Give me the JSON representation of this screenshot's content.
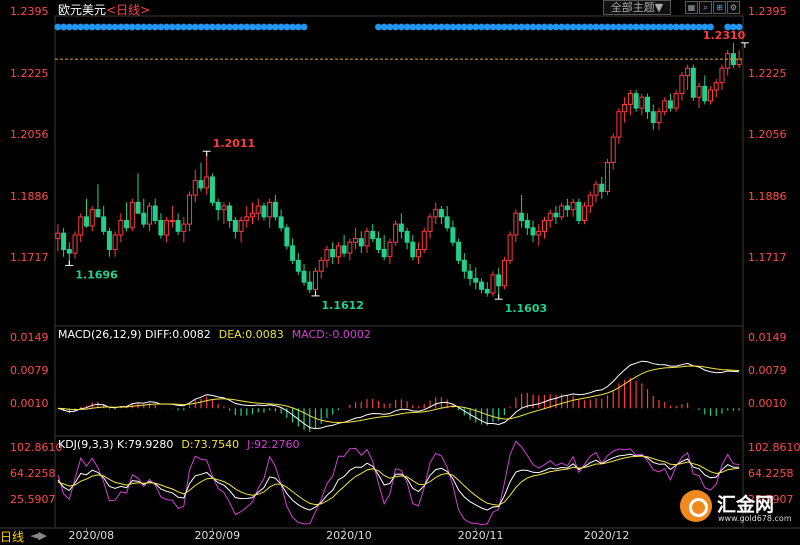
{
  "title": {
    "symbol": "欧元美元",
    "period": "<日线>"
  },
  "toolbar": {
    "menu_label": "全部主题▼",
    "button_icons": [
      "grid-icon",
      "search-icon",
      "line-type-icon",
      "settings-icon"
    ]
  },
  "footer": {
    "day_tab": "日线",
    "nav_glyph": "◄▶"
  },
  "watermark": {
    "brand": "汇金网",
    "url": "www.gold678.com"
  },
  "colors": {
    "up": "#ff3c3c",
    "down": "#21d08c",
    "dot": "#2196f3",
    "diff": "#ffffff",
    "dea": "#f0e442",
    "macd": "#d23fd7",
    "kdj_k": "#ffffff",
    "kdj_d": "#f0e442",
    "kdj_j": "#d23fd7"
  },
  "chart_data": [
    {
      "type": "candlestick",
      "title": "欧元美元<日线>",
      "ylim": [
        1.154,
        1.2395
      ],
      "yticks": [
        "1.2395",
        "1.2225",
        "1.2056",
        "1.1886",
        "1.1717"
      ],
      "xticks": [
        "2020/08",
        "2020/09",
        "2020/10",
        "2020/11",
        "2020/12"
      ],
      "xtick_index": [
        5,
        27,
        50,
        73,
        95
      ],
      "current_price": 1.2265,
      "annotations": [
        {
          "label": "1.2011",
          "index": 26,
          "value": 1.2011,
          "type": "high"
        },
        {
          "label": "1.1696",
          "index": 2,
          "value": 1.1696,
          "type": "low"
        },
        {
          "label": "1.1612",
          "index": 45,
          "value": 1.1612,
          "type": "low"
        },
        {
          "label": "1.1603",
          "index": 77,
          "value": 1.1603,
          "type": "low"
        },
        {
          "label": "1.2310",
          "index": 120,
          "value": 1.231,
          "type": "high"
        }
      ],
      "candles": [
        [
          1.177,
          1.181,
          1.1735,
          1.1785
        ],
        [
          1.1785,
          1.18,
          1.172,
          1.174
        ],
        [
          1.174,
          1.176,
          1.1696,
          1.173
        ],
        [
          1.173,
          1.179,
          1.1715,
          1.178
        ],
        [
          1.178,
          1.184,
          1.176,
          1.183
        ],
        [
          1.183,
          1.188,
          1.18,
          1.1805
        ],
        [
          1.1805,
          1.186,
          1.179,
          1.185
        ],
        [
          1.185,
          1.192,
          1.183,
          1.183
        ],
        [
          1.183,
          1.186,
          1.178,
          1.179
        ],
        [
          1.179,
          1.18,
          1.172,
          1.174
        ],
        [
          1.174,
          1.179,
          1.172,
          1.178
        ],
        [
          1.178,
          1.184,
          1.176,
          1.182
        ],
        [
          1.182,
          1.187,
          1.179,
          1.18
        ],
        [
          1.18,
          1.188,
          1.179,
          1.187
        ],
        [
          1.187,
          1.195,
          1.184,
          1.184
        ],
        [
          1.184,
          1.188,
          1.18,
          1.181
        ],
        [
          1.181,
          1.187,
          1.179,
          1.186
        ],
        [
          1.186,
          1.188,
          1.181,
          1.182
        ],
        [
          1.182,
          1.184,
          1.177,
          1.178
        ],
        [
          1.178,
          1.183,
          1.176,
          1.182
        ],
        [
          1.182,
          1.186,
          1.18,
          1.182
        ],
        [
          1.182,
          1.184,
          1.178,
          1.179
        ],
        [
          1.179,
          1.183,
          1.176,
          1.181
        ],
        [
          1.181,
          1.19,
          1.179,
          1.189
        ],
        [
          1.189,
          1.196,
          1.187,
          1.193
        ],
        [
          1.193,
          1.198,
          1.19,
          1.191
        ],
        [
          1.191,
          1.2011,
          1.189,
          1.194
        ],
        [
          1.194,
          1.195,
          1.186,
          1.187
        ],
        [
          1.187,
          1.188,
          1.182,
          1.185
        ],
        [
          1.185,
          1.187,
          1.181,
          1.186
        ],
        [
          1.186,
          1.187,
          1.18,
          1.182
        ],
        [
          1.182,
          1.183,
          1.177,
          1.179
        ],
        [
          1.179,
          1.183,
          1.176,
          1.182
        ],
        [
          1.182,
          1.186,
          1.18,
          1.183
        ],
        [
          1.183,
          1.187,
          1.181,
          1.184
        ],
        [
          1.184,
          1.188,
          1.182,
          1.186
        ],
        [
          1.186,
          1.187,
          1.182,
          1.183
        ],
        [
          1.183,
          1.188,
          1.18,
          1.187
        ],
        [
          1.187,
          1.189,
          1.182,
          1.183
        ],
        [
          1.183,
          1.185,
          1.179,
          1.18
        ],
        [
          1.18,
          1.181,
          1.174,
          1.175
        ],
        [
          1.175,
          1.177,
          1.17,
          1.171
        ],
        [
          1.171,
          1.173,
          1.167,
          1.168
        ],
        [
          1.168,
          1.17,
          1.164,
          1.165
        ],
        [
          1.165,
          1.168,
          1.162,
          1.163
        ],
        [
          1.163,
          1.169,
          1.1612,
          1.168
        ],
        [
          1.168,
          1.172,
          1.166,
          1.171
        ],
        [
          1.171,
          1.175,
          1.169,
          1.174
        ],
        [
          1.174,
          1.176,
          1.17,
          1.172
        ],
        [
          1.172,
          1.176,
          1.17,
          1.175
        ],
        [
          1.175,
          1.178,
          1.172,
          1.173
        ],
        [
          1.173,
          1.177,
          1.171,
          1.176
        ],
        [
          1.176,
          1.18,
          1.174,
          1.177
        ],
        [
          1.177,
          1.179,
          1.173,
          1.175
        ],
        [
          1.175,
          1.18,
          1.173,
          1.179
        ],
        [
          1.179,
          1.181,
          1.176,
          1.177
        ],
        [
          1.177,
          1.179,
          1.173,
          1.174
        ],
        [
          1.174,
          1.178,
          1.171,
          1.172
        ],
        [
          1.172,
          1.177,
          1.17,
          1.176
        ],
        [
          1.176,
          1.182,
          1.175,
          1.181
        ],
        [
          1.181,
          1.184,
          1.177,
          1.179
        ],
        [
          1.179,
          1.18,
          1.174,
          1.176
        ],
        [
          1.176,
          1.178,
          1.171,
          1.172
        ],
        [
          1.172,
          1.176,
          1.17,
          1.174
        ],
        [
          1.174,
          1.18,
          1.173,
          1.179
        ],
        [
          1.179,
          1.184,
          1.177,
          1.183
        ],
        [
          1.183,
          1.187,
          1.181,
          1.185
        ],
        [
          1.185,
          1.186,
          1.181,
          1.183
        ],
        [
          1.183,
          1.186,
          1.179,
          1.18
        ],
        [
          1.18,
          1.182,
          1.175,
          1.176
        ],
        [
          1.176,
          1.177,
          1.17,
          1.171
        ],
        [
          1.171,
          1.173,
          1.166,
          1.168
        ],
        [
          1.168,
          1.17,
          1.164,
          1.166
        ],
        [
          1.166,
          1.169,
          1.163,
          1.165
        ],
        [
          1.165,
          1.166,
          1.162,
          1.163
        ],
        [
          1.163,
          1.165,
          1.161,
          1.162
        ],
        [
          1.162,
          1.168,
          1.161,
          1.167
        ],
        [
          1.167,
          1.169,
          1.1603,
          1.164
        ],
        [
          1.164,
          1.172,
          1.163,
          1.171
        ],
        [
          1.171,
          1.179,
          1.17,
          1.178
        ],
        [
          1.178,
          1.185,
          1.176,
          1.184
        ],
        [
          1.184,
          1.189,
          1.18,
          1.182
        ],
        [
          1.182,
          1.184,
          1.178,
          1.18
        ],
        [
          1.18,
          1.182,
          1.176,
          1.178
        ],
        [
          1.178,
          1.181,
          1.175,
          1.179
        ],
        [
          1.179,
          1.183,
          1.177,
          1.182
        ],
        [
          1.182,
          1.185,
          1.18,
          1.184
        ],
        [
          1.184,
          1.186,
          1.181,
          1.183
        ],
        [
          1.183,
          1.187,
          1.182,
          1.186
        ],
        [
          1.186,
          1.188,
          1.183,
          1.185
        ],
        [
          1.185,
          1.188,
          1.183,
          1.187
        ],
        [
          1.187,
          1.188,
          1.181,
          1.182
        ],
        [
          1.182,
          1.187,
          1.181,
          1.186
        ],
        [
          1.186,
          1.19,
          1.184,
          1.189
        ],
        [
          1.189,
          1.193,
          1.187,
          1.192
        ],
        [
          1.192,
          1.194,
          1.188,
          1.19
        ],
        [
          1.19,
          1.199,
          1.189,
          1.198
        ],
        [
          1.198,
          1.206,
          1.196,
          1.205
        ],
        [
          1.205,
          1.213,
          1.203,
          1.212
        ],
        [
          1.212,
          1.216,
          1.209,
          1.214
        ],
        [
          1.214,
          1.218,
          1.211,
          1.217
        ],
        [
          1.217,
          1.218,
          1.212,
          1.213
        ],
        [
          1.213,
          1.217,
          1.211,
          1.216
        ],
        [
          1.216,
          1.217,
          1.21,
          1.212
        ],
        [
          1.212,
          1.214,
          1.207,
          1.209
        ],
        [
          1.209,
          1.213,
          1.207,
          1.212
        ],
        [
          1.212,
          1.216,
          1.211,
          1.215
        ],
        [
          1.215,
          1.217,
          1.212,
          1.213
        ],
        [
          1.213,
          1.218,
          1.212,
          1.217
        ],
        [
          1.217,
          1.223,
          1.215,
          1.222
        ],
        [
          1.222,
          1.225,
          1.218,
          1.224
        ],
        [
          1.224,
          1.225,
          1.215,
          1.216
        ],
        [
          1.216,
          1.22,
          1.213,
          1.219
        ],
        [
          1.219,
          1.222,
          1.214,
          1.215
        ],
        [
          1.215,
          1.219,
          1.214,
          1.218
        ],
        [
          1.218,
          1.221,
          1.216,
          1.22
        ],
        [
          1.22,
          1.225,
          1.218,
          1.224
        ],
        [
          1.224,
          1.229,
          1.222,
          1.228
        ],
        [
          1.228,
          1.231,
          1.224,
          1.225
        ],
        [
          1.225,
          1.229,
          1.224,
          1.2265
        ]
      ]
    },
    {
      "type": "line",
      "title": "MACD(26,12,9)",
      "legend": [
        {
          "label": "DIFF:0.0082",
          "color": "#ffffff"
        },
        {
          "label": "DEA:0.0083",
          "color": "#f0e442"
        },
        {
          "label": "MACD:-0.0002",
          "color": "#d23fd7"
        }
      ],
      "yticks": [
        "0.0149",
        "0.0079",
        "0.0010"
      ],
      "ylim": [
        -0.005,
        0.0165
      ]
    },
    {
      "type": "line",
      "title": "KDJ(9,3,3)",
      "legend": [
        {
          "label": "K:79.9280",
          "color": "#ffffff"
        },
        {
          "label": "D:73.7540",
          "color": "#f0e442"
        },
        {
          "label": "J:92.2760",
          "color": "#d23fd7"
        }
      ],
      "yticks": [
        "102.8610",
        "64.2258",
        "25.5907"
      ],
      "ylim": [
        -15,
        115
      ]
    }
  ]
}
